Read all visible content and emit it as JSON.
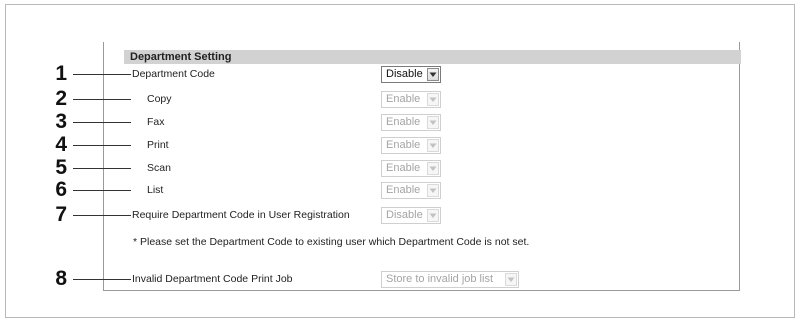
{
  "section": {
    "title": "Department Setting"
  },
  "rows": [
    {
      "callout": "1",
      "label": "Department Code",
      "value": "Disable",
      "enabled": true
    },
    {
      "callout": "2",
      "label": "Copy",
      "value": "Enable",
      "enabled": false
    },
    {
      "callout": "3",
      "label": "Fax",
      "value": "Enable",
      "enabled": false
    },
    {
      "callout": "4",
      "label": "Print",
      "value": "Enable",
      "enabled": false
    },
    {
      "callout": "5",
      "label": "Scan",
      "value": "Enable",
      "enabled": false
    },
    {
      "callout": "6",
      "label": "List",
      "value": "Enable",
      "enabled": false
    },
    {
      "callout": "7",
      "label": "Require Department Code in User Registration",
      "value": "Disable",
      "enabled": false
    },
    {
      "callout": "8",
      "label": "Invalid Department Code Print Job",
      "value": "Store to invalid job list",
      "enabled": false
    }
  ],
  "note": "* Please set the Department Code to existing user which Department Code is not set.",
  "icons": {
    "dropdown": "chevron-down-icon"
  },
  "colors": {
    "header_bg": "#d2d2d2",
    "disabled_text": "#a4a4a4"
  }
}
